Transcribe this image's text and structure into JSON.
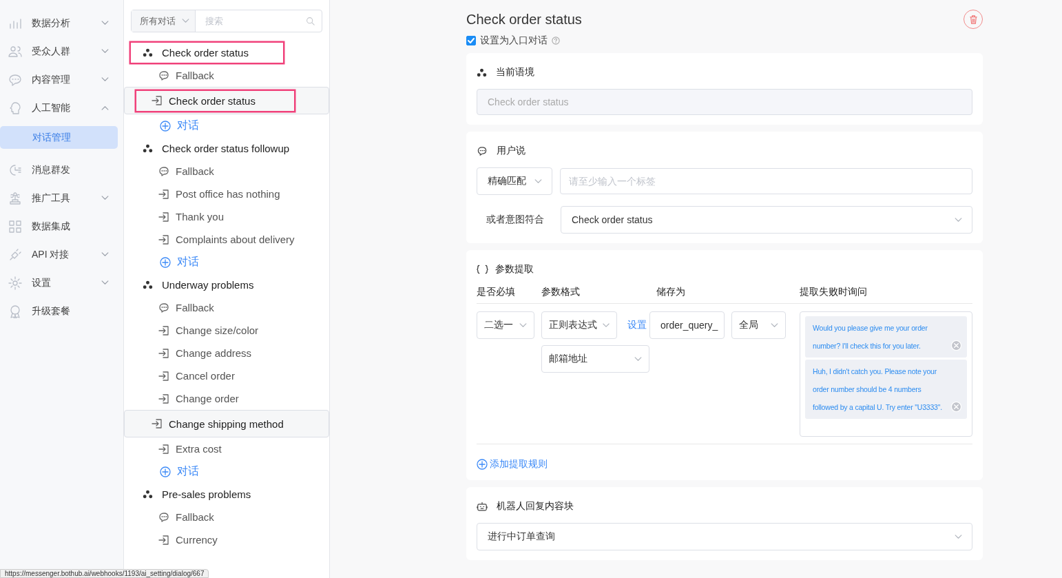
{
  "sidebar": {
    "items": [
      {
        "kind": "menu",
        "label": "数据分析",
        "expanded": false
      },
      {
        "kind": "menu",
        "label": "受众人群",
        "expanded": false
      },
      {
        "kind": "menu",
        "label": "内容管理",
        "expanded": false
      },
      {
        "kind": "menu",
        "label": "人工智能",
        "expanded": true
      },
      {
        "kind": "submenu",
        "label": "对话管理",
        "selected": true
      },
      {
        "kind": "menu",
        "label": "消息群发"
      },
      {
        "kind": "menu",
        "label": "推广工具",
        "expanded": false
      },
      {
        "kind": "menu",
        "label": "数据集成"
      },
      {
        "kind": "menu",
        "label": "API 对接",
        "expanded": false
      },
      {
        "kind": "menu",
        "label": "设置",
        "expanded": false
      },
      {
        "kind": "menu",
        "label": "升级套餐"
      }
    ]
  },
  "dialog_list": {
    "scope": "所有对话",
    "search_placeholder": "搜索",
    "groups": [
      {
        "title": "Check order status",
        "highlighted": true,
        "children": [
          {
            "kind": "fallback",
            "label": "Fallback",
            "selected": false,
            "highlighted": false
          },
          {
            "kind": "intent",
            "label": "Check order status",
            "selected": true,
            "highlighted": true
          },
          {
            "kind": "add",
            "label": "对话",
            "selected": false
          }
        ]
      },
      {
        "title": "Check order status followup",
        "highlighted": false,
        "children": [
          {
            "kind": "fallback",
            "label": "Fallback",
            "selected": false,
            "highlighted": false
          },
          {
            "kind": "intent",
            "label": "Post office has nothing",
            "selected": false,
            "highlighted": false
          },
          {
            "kind": "intent",
            "label": "Thank you",
            "selected": false,
            "highlighted": false
          },
          {
            "kind": "intent",
            "label": "Complaints about delivery",
            "selected": false,
            "highlighted": false
          },
          {
            "kind": "add",
            "label": "对话",
            "selected": false
          }
        ]
      },
      {
        "title": "Underway problems",
        "highlighted": false,
        "children": [
          {
            "kind": "fallback",
            "label": "Fallback",
            "selected": false,
            "highlighted": false
          },
          {
            "kind": "intent",
            "label": "Change size/color",
            "selected": false,
            "highlighted": false
          },
          {
            "kind": "intent",
            "label": "Change address",
            "selected": false,
            "highlighted": false
          },
          {
            "kind": "intent",
            "label": "Cancel order",
            "selected": false,
            "highlighted": false
          },
          {
            "kind": "intent",
            "label": "Change order",
            "selected": false,
            "highlighted": false
          },
          {
            "kind": "intent",
            "label": "Change shipping method",
            "selected": true,
            "highlighted": false
          },
          {
            "kind": "intent",
            "label": "Extra cost",
            "selected": false,
            "highlighted": false
          },
          {
            "kind": "add",
            "label": "对话",
            "selected": false
          }
        ]
      },
      {
        "title": "Pre-sales problems",
        "highlighted": false,
        "children": [
          {
            "kind": "fallback",
            "label": "Fallback",
            "selected": false,
            "highlighted": false
          },
          {
            "kind": "intent",
            "label": "Currency",
            "selected": false,
            "highlighted": false
          }
        ]
      }
    ]
  },
  "editor": {
    "title": "Check order status",
    "entry_dialog": {
      "label": "设置为入口对话",
      "checked": true
    },
    "context": {
      "heading": "当前语境",
      "value": "Check order status"
    },
    "user_says": {
      "heading": "用户说",
      "match_mode": "精确匹配",
      "tag_placeholder": "请至少输入一个标签",
      "intent_label": "或者意图符合",
      "intent_value": "Check order status"
    },
    "params": {
      "heading": "参数提取",
      "columns": [
        "是否必填",
        "参数格式",
        "储存为",
        "提取失败时询问"
      ],
      "rows": [
        {
          "required": "二选一",
          "format": "正则表达式",
          "format_option": "邮箱地址",
          "setup_link": "设置",
          "store_as": "order_query_",
          "scope": "全局",
          "prompts": [
            "Would you please give me your order number? I'll check this for you later.",
            "Huh, I didn't catch you. Please note your order number should be 4 numbers followed by a capital U. Try enter \"U3333\"."
          ]
        }
      ],
      "add_rule": "添加提取规则"
    },
    "bot_reply": {
      "heading": "机器人回复内容块",
      "value": "进行中订单查询"
    }
  },
  "status_url": "https://messenger.bothub.ai/webhooks/1193/ai_setting/dialog/667"
}
